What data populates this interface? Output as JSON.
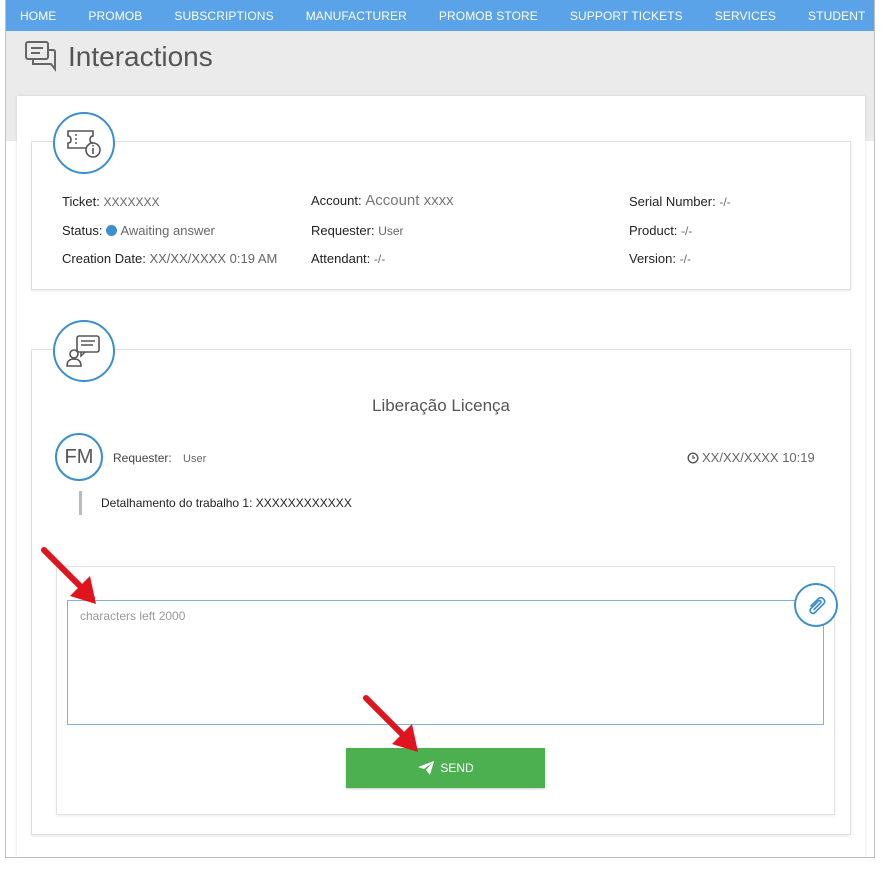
{
  "nav": {
    "items": [
      "HOME",
      "PROMOB",
      "SUBSCRIPTIONS",
      "MANUFACTURER",
      "PROMOB STORE",
      "SUPPORT TICKETS",
      "SERVICES",
      "STUDENT"
    ]
  },
  "page": {
    "title": "Interactions"
  },
  "ticket": {
    "ticket_label": "Ticket:",
    "ticket_value": "XXXXXXX",
    "status_label": "Status:",
    "status_value": "Awaiting answer",
    "creation_label": "Creation Date:",
    "creation_value": "XX/XX/XXXX 0:19 AM",
    "account_label": "Account:",
    "account_value": "Account xxxx",
    "requester_label": "Requester:",
    "requester_value": "User",
    "attendant_label": "Attendant:",
    "attendant_value": "-/-",
    "serial_label": "Serial Number:",
    "serial_value": "-/-",
    "product_label": "Product:",
    "product_value": "-/-",
    "version_label": "Version:",
    "version_value": "-/-",
    "status_color": "#3b8fd0"
  },
  "conversation": {
    "title": "Liberação Licença",
    "avatar_initials": "FM",
    "requester_label": "Requester:",
    "requester_value": "User",
    "timestamp": "XX/XX/XXXX 10:19",
    "message": "Detalhamento do trabalho 1: XXXXXXXXXXXX"
  },
  "reply": {
    "placeholder": "characters left 2000",
    "send_label": "SEND",
    "send_color": "#4caf50"
  },
  "icons": {
    "ticket_icon": "ticket-info-icon",
    "chat_icon": "user-chat-icon",
    "clip_icon": "paperclip-icon",
    "send_icon": "paper-plane-icon",
    "clock_icon": "clock-icon"
  },
  "colors": {
    "nav": "#5aa3e8",
    "accent": "#3b8fd0",
    "annotation_arrow": "#e0141e"
  }
}
